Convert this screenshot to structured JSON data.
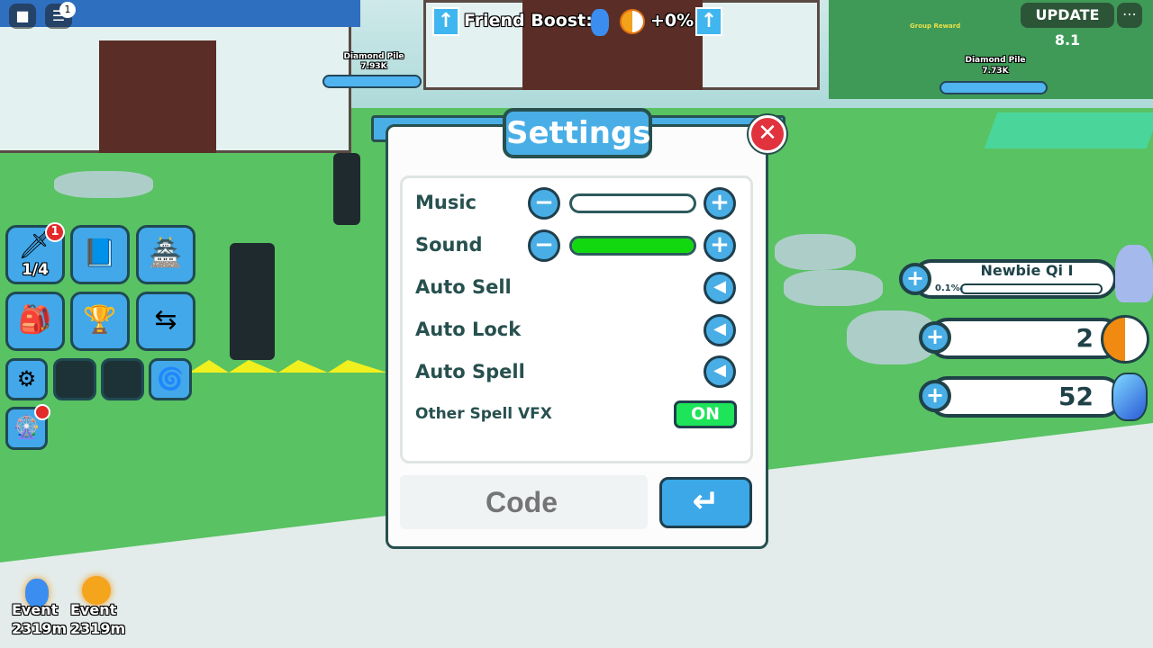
{
  "topbar": {
    "chat_badge": "1",
    "update_label": "UPDATE 8.1",
    "more_icon": "ellipsis-icon"
  },
  "friend_boost": {
    "label": "Friend Boost:",
    "value": "+0%"
  },
  "world_labels": {
    "diamond_pile_left": {
      "name": "Diamond Pile",
      "value": "7.93K"
    },
    "diamond_pile_right": {
      "name": "Diamond Pile",
      "value": "7.73K"
    },
    "group_reward": "Group Reward"
  },
  "settings": {
    "title": "Settings",
    "rows": [
      {
        "label": "Music",
        "type": "slider",
        "level": 0
      },
      {
        "label": "Sound",
        "type": "slider",
        "level": 1.0
      },
      {
        "label": "Auto Sell",
        "type": "arrow-toggle"
      },
      {
        "label": "Auto Lock",
        "type": "arrow-toggle"
      },
      {
        "label": "Auto Spell",
        "type": "arrow-toggle"
      },
      {
        "label": "Other Spell VFX",
        "type": "switch",
        "value": "ON"
      }
    ],
    "code_placeholder": "Code",
    "colors": {
      "accent": "#49aee6",
      "on": "#1ee45a",
      "slider_fill": "#12d90f",
      "close": "#e0333e"
    }
  },
  "left_menu": {
    "weapons_count": "1/4",
    "weapons_badge": "1"
  },
  "stats": {
    "rank": {
      "name": "Newbie Qi I",
      "progress_label": "0.1%",
      "progress": 0.1
    },
    "yin_yang": "2",
    "gems": "52"
  },
  "events": [
    {
      "label": "Event",
      "time": "2319m"
    },
    {
      "label": "Event",
      "time": "2319m"
    }
  ]
}
